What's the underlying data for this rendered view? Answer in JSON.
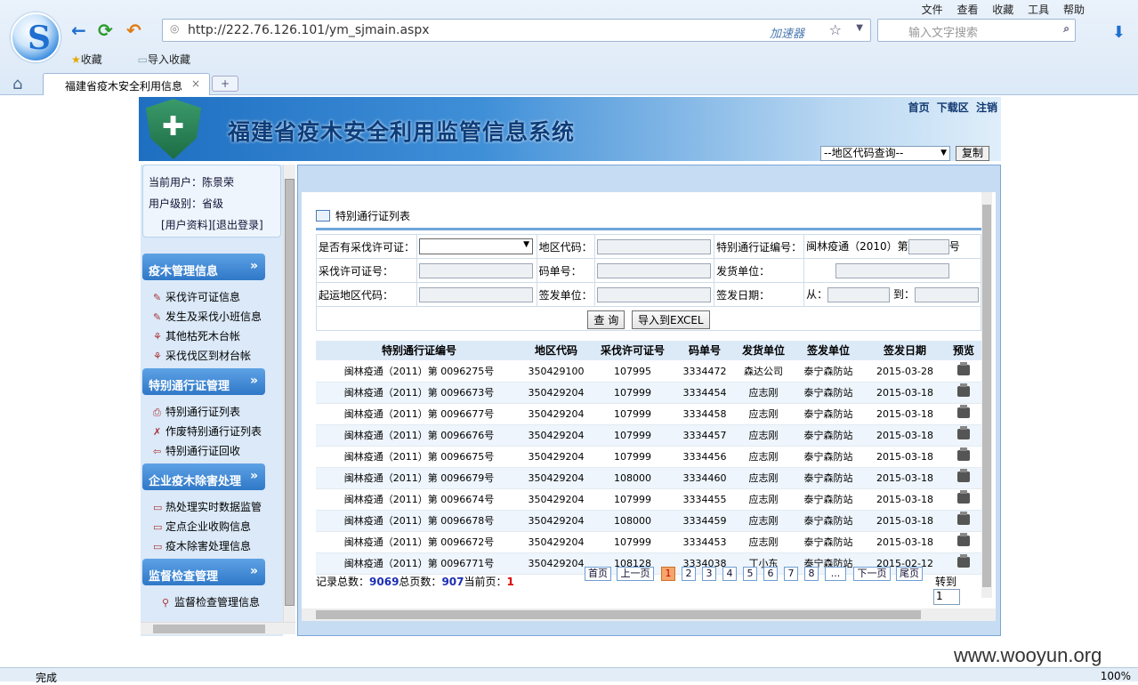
{
  "browser": {
    "url": "http://222.76.126.101/ym_sjmain.aspx",
    "accelerator": "加速器",
    "search_placeholder": "输入文字搜索",
    "menu": [
      "文件",
      "查看",
      "收藏",
      "工具",
      "帮助"
    ],
    "fav_items": [
      "收藏",
      "导入收藏"
    ],
    "tab_title": "福建省疫木安全利用信息",
    "status_left": "完成",
    "status_right": "100%"
  },
  "site": {
    "title": "福建省疫木安全利用监管信息系统",
    "links": [
      "首页",
      "下载区",
      "注销"
    ],
    "region_select": "--地区代码查询--",
    "copy_btn": "复制"
  },
  "sidebar": {
    "current_user": "当前用户：陈景荣",
    "user_level": "用户级别：省级",
    "user_links": "[用户资料][退出登录]",
    "sections": [
      {
        "title": "疫木管理信息",
        "items": [
          "采伐许可证信息",
          "发生及采伐小班信息",
          "其他枯死木台帐",
          "采伐伐区到材台帐"
        ]
      },
      {
        "title": "特别通行证管理",
        "items": [
          "特别通行证列表",
          "作废特别通行证列表",
          "特别通行证回收"
        ]
      },
      {
        "title": "企业疫木除害处理",
        "items": [
          "热处理实时数据监管",
          "定点企业收购信息",
          "疫木除害处理信息"
        ]
      },
      {
        "title": "监督检查管理",
        "items": [
          "监督检查管理信息"
        ]
      }
    ]
  },
  "list": {
    "title": "特别通行证列表",
    "filters": {
      "has_permit": "是否有采伐许可证：",
      "region_code": "地区代码：",
      "pass_no": "特别通行证编号：",
      "pass_prefix": "闽林疫通（2010）第",
      "pass_suffix": "号",
      "permit_no": "采伐许可证号：",
      "code_no": "码单号：",
      "shipper": "发货单位：",
      "origin_code": "起运地区代码：",
      "issuer": "签发单位：",
      "issue_date": "签发日期：",
      "from": "从：",
      "to": "到："
    },
    "query_btn": "查 询",
    "export_btn": "导入到EXCEL",
    "columns": [
      "特别通行证编号",
      "地区代码",
      "采伐许可证号",
      "码单号",
      "发货单位",
      "签发单位",
      "签发日期",
      "预览"
    ],
    "rows": [
      [
        "闽林疫通（2011）第 0096275号",
        "350429100",
        "107995",
        "3334472",
        "森达公司",
        "泰宁森防站",
        "2015-03-28"
      ],
      [
        "闽林疫通（2011）第 0096673号",
        "350429204",
        "107999",
        "3334454",
        "应志刚",
        "泰宁森防站",
        "2015-03-18"
      ],
      [
        "闽林疫通（2011）第 0096677号",
        "350429204",
        "107999",
        "3334458",
        "应志刚",
        "泰宁森防站",
        "2015-03-18"
      ],
      [
        "闽林疫通（2011）第 0096676号",
        "350429204",
        "107999",
        "3334457",
        "应志刚",
        "泰宁森防站",
        "2015-03-18"
      ],
      [
        "闽林疫通（2011）第 0096675号",
        "350429204",
        "107999",
        "3334456",
        "应志刚",
        "泰宁森防站",
        "2015-03-18"
      ],
      [
        "闽林疫通（2011）第 0096679号",
        "350429204",
        "108000",
        "3334460",
        "应志刚",
        "泰宁森防站",
        "2015-03-18"
      ],
      [
        "闽林疫通（2011）第 0096674号",
        "350429204",
        "107999",
        "3334455",
        "应志刚",
        "泰宁森防站",
        "2015-03-18"
      ],
      [
        "闽林疫通（2011）第 0096678号",
        "350429204",
        "108000",
        "3334459",
        "应志刚",
        "泰宁森防站",
        "2015-03-18"
      ],
      [
        "闽林疫通（2011）第 0096672号",
        "350429204",
        "107999",
        "3334453",
        "应志刚",
        "泰宁森防站",
        "2015-03-18"
      ],
      [
        "闽林疫通（2011）第 0096771号",
        "350429204",
        "108128",
        "3334038",
        "丁小东",
        "泰宁森防站",
        "2015-02-12"
      ]
    ],
    "pager": {
      "total_label": "记录总数：",
      "total": "9069",
      "pages_label": "总页数：",
      "pages": "907",
      "current_label": "当前页：",
      "current": "1",
      "first": "首页",
      "prev": "上一页",
      "numbers": [
        "1",
        "2",
        "3",
        "4",
        "5",
        "6",
        "7",
        "8",
        "..."
      ],
      "next": "下一页",
      "last": "尾页",
      "goto_label": "转到",
      "goto_value": "1"
    }
  },
  "watermark": "www.wooyun.org"
}
